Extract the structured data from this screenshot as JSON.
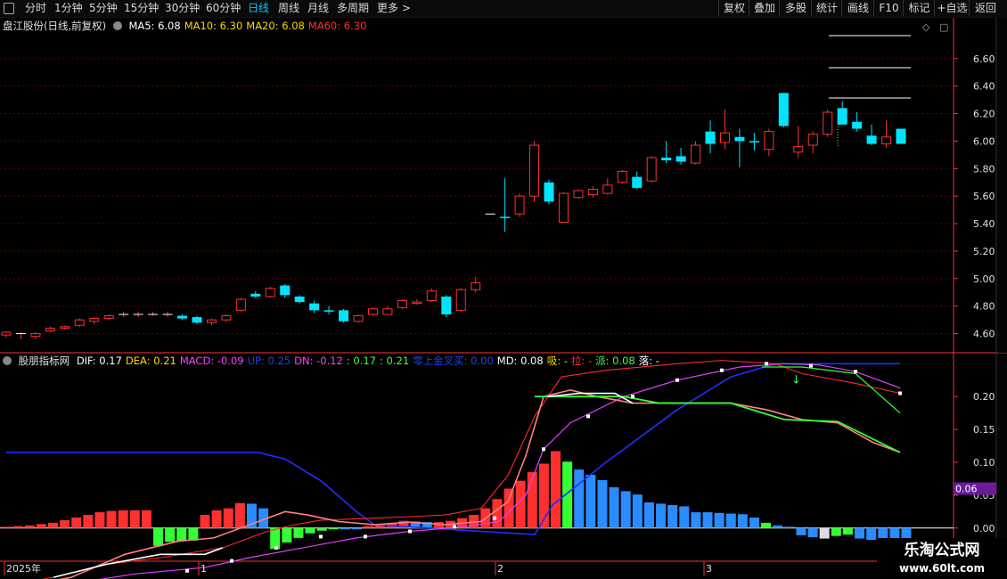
{
  "topbar": {
    "left_items": [
      {
        "label": "分时",
        "active": false
      },
      {
        "label": "1分钟",
        "active": false
      },
      {
        "label": "5分钟",
        "active": false
      },
      {
        "label": "15分钟",
        "active": false
      },
      {
        "label": "30分钟",
        "active": false
      },
      {
        "label": "60分钟",
        "active": false
      },
      {
        "label": "日线",
        "active": true
      },
      {
        "label": "周线",
        "active": false
      },
      {
        "label": "月线",
        "active": false
      },
      {
        "label": "多周期",
        "active": false
      },
      {
        "label": "更多 >",
        "active": false
      }
    ],
    "right_items": [
      "复权",
      "叠加",
      "多股",
      "统计",
      "画线",
      "F10",
      "标记",
      "+自选",
      "返回"
    ]
  },
  "price_panel": {
    "title": "盘江股份(日线,前复权)",
    "ma": [
      {
        "label": "MA5: 6.08",
        "color": "#ffffff"
      },
      {
        "label": "MA10: 6.30",
        "color": "#ffd700"
      },
      {
        "label": "MA20: 6.08",
        "color": "#ffd700"
      },
      {
        "label": "MA60: 6.30",
        "color": "#ff3030"
      }
    ],
    "y_ticks": [
      "6.60",
      "6.40",
      "6.20",
      "6.00",
      "5.80",
      "5.60",
      "5.40",
      "5.20",
      "5.00",
      "4.80",
      "4.60"
    ]
  },
  "indicator_panel": {
    "title": "股朋指标网",
    "items": [
      {
        "label": "DIF: 0.17",
        "color": "#ffffff"
      },
      {
        "label": "DEA: 0.21",
        "color": "#ffd700"
      },
      {
        "label": "MACD: -0.09",
        "color": "#ff40ff"
      },
      {
        "label": "UP: 0.25",
        "color": "#2040ff"
      },
      {
        "label": "DN: -0.12",
        "color": "#ff40ff"
      },
      {
        "label": ": 0.17",
        "color": "#40ff40"
      },
      {
        "label": ": 0.21",
        "color": "#40ff40"
      },
      {
        "label": "零上金叉买: 0.00",
        "color": "#2040ff"
      },
      {
        "label": "MD: 0.08",
        "color": "#ffffff"
      },
      {
        "label": "吸: -",
        "color": "#ffd700"
      },
      {
        "label": "拉: -",
        "color": "#ff3030"
      },
      {
        "label": "派: 0.08",
        "color": "#40ff40"
      },
      {
        "label": "落: -",
        "color": "#ffffff"
      }
    ],
    "y_ticks": [
      "0.20",
      "0.15",
      "0.10",
      "0.05",
      "0.00"
    ],
    "value_badge": "0.06"
  },
  "time_axis": [
    {
      "label": "2025年"
    },
    {
      "label": "1"
    },
    {
      "label": "2"
    },
    {
      "label": "3"
    }
  ],
  "watermark": {
    "line1": "乐淘公式网",
    "line2": "www.60lt.com"
  },
  "colors": {
    "up": "#ff3030",
    "down": "#00e5ff",
    "grid": "#5a0000",
    "axis": "#ff3030"
  },
  "chart_data": {
    "type": "candlestick",
    "ylim": [
      4.5,
      6.78
    ],
    "candles": [
      {
        "o": 4.59,
        "h": 4.62,
        "l": 4.57,
        "c": 4.61
      },
      {
        "o": 4.6,
        "h": 4.61,
        "l": 4.56,
        "c": 4.6
      },
      {
        "o": 4.58,
        "h": 4.61,
        "l": 4.56,
        "c": 4.6
      },
      {
        "o": 4.62,
        "h": 4.65,
        "l": 4.61,
        "c": 4.64
      },
      {
        "o": 4.64,
        "h": 4.66,
        "l": 4.63,
        "c": 4.65
      },
      {
        "o": 4.66,
        "h": 4.71,
        "l": 4.65,
        "c": 4.7
      },
      {
        "o": 4.69,
        "h": 4.72,
        "l": 4.67,
        "c": 4.71
      },
      {
        "o": 4.71,
        "h": 4.74,
        "l": 4.7,
        "c": 4.73
      },
      {
        "o": 4.74,
        "h": 4.76,
        "l": 4.72,
        "c": 4.74
      },
      {
        "o": 4.74,
        "h": 4.76,
        "l": 4.72,
        "c": 4.74
      },
      {
        "o": 4.74,
        "h": 4.76,
        "l": 4.73,
        "c": 4.74
      },
      {
        "o": 4.74,
        "h": 4.76,
        "l": 4.72,
        "c": 4.74
      },
      {
        "o": 4.73,
        "h": 4.74,
        "l": 4.7,
        "c": 4.71
      },
      {
        "o": 4.72,
        "h": 4.73,
        "l": 4.67,
        "c": 4.68
      },
      {
        "o": 4.68,
        "h": 4.71,
        "l": 4.66,
        "c": 4.7
      },
      {
        "o": 4.7,
        "h": 4.74,
        "l": 4.69,
        "c": 4.73
      },
      {
        "o": 4.77,
        "h": 4.86,
        "l": 4.76,
        "c": 4.85
      },
      {
        "o": 4.89,
        "h": 4.91,
        "l": 4.86,
        "c": 4.87
      },
      {
        "o": 4.87,
        "h": 4.94,
        "l": 4.86,
        "c": 4.93
      },
      {
        "o": 4.95,
        "h": 4.96,
        "l": 4.86,
        "c": 4.88
      },
      {
        "o": 4.87,
        "h": 4.88,
        "l": 4.82,
        "c": 4.83
      },
      {
        "o": 4.82,
        "h": 4.84,
        "l": 4.75,
        "c": 4.77
      },
      {
        "o": 4.77,
        "h": 4.8,
        "l": 4.74,
        "c": 4.76
      },
      {
        "o": 4.77,
        "h": 4.78,
        "l": 4.68,
        "c": 4.69
      },
      {
        "o": 4.69,
        "h": 4.74,
        "l": 4.68,
        "c": 4.73
      },
      {
        "o": 4.74,
        "h": 4.79,
        "l": 4.73,
        "c": 4.78
      },
      {
        "o": 4.74,
        "h": 4.8,
        "l": 4.74,
        "c": 4.78
      },
      {
        "o": 4.79,
        "h": 4.85,
        "l": 4.78,
        "c": 4.84
      },
      {
        "o": 4.82,
        "h": 4.85,
        "l": 4.81,
        "c": 4.83
      },
      {
        "o": 4.84,
        "h": 4.93,
        "l": 4.83,
        "c": 4.91
      },
      {
        "o": 4.87,
        "h": 4.88,
        "l": 4.72,
        "c": 4.74
      },
      {
        "o": 4.77,
        "h": 4.93,
        "l": 4.76,
        "c": 4.92
      },
      {
        "o": 4.92,
        "h": 5.01,
        "l": 4.9,
        "c": 4.97
      },
      {
        "o": 5.47,
        "h": 5.47,
        "l": 5.47,
        "c": 5.47
      },
      {
        "o": 5.45,
        "h": 5.73,
        "l": 5.34,
        "c": 5.44
      },
      {
        "o": 5.47,
        "h": 5.62,
        "l": 5.45,
        "c": 5.6
      },
      {
        "o": 5.6,
        "h": 6.0,
        "l": 5.56,
        "c": 5.97
      },
      {
        "o": 5.7,
        "h": 5.72,
        "l": 5.54,
        "c": 5.56
      },
      {
        "o": 5.41,
        "h": 5.63,
        "l": 5.41,
        "c": 5.62
      },
      {
        "o": 5.59,
        "h": 5.65,
        "l": 5.58,
        "c": 5.64
      },
      {
        "o": 5.61,
        "h": 5.67,
        "l": 5.59,
        "c": 5.65
      },
      {
        "o": 5.62,
        "h": 5.73,
        "l": 5.61,
        "c": 5.68
      },
      {
        "o": 5.7,
        "h": 5.79,
        "l": 5.69,
        "c": 5.78
      },
      {
        "o": 5.74,
        "h": 5.78,
        "l": 5.65,
        "c": 5.66
      },
      {
        "o": 5.71,
        "h": 5.89,
        "l": 5.7,
        "c": 5.88
      },
      {
        "o": 5.88,
        "h": 6.0,
        "l": 5.84,
        "c": 5.86
      },
      {
        "o": 5.89,
        "h": 5.95,
        "l": 5.83,
        "c": 5.85
      },
      {
        "o": 5.84,
        "h": 6.0,
        "l": 5.83,
        "c": 5.97
      },
      {
        "o": 6.07,
        "h": 6.15,
        "l": 5.91,
        "c": 5.98
      },
      {
        "o": 5.99,
        "h": 6.23,
        "l": 5.94,
        "c": 6.06
      },
      {
        "o": 6.03,
        "h": 6.09,
        "l": 5.81,
        "c": 6.0
      },
      {
        "o": 6.0,
        "h": 6.06,
        "l": 5.93,
        "c": 5.99
      },
      {
        "o": 5.94,
        "h": 6.09,
        "l": 5.89,
        "c": 6.07
      },
      {
        "o": 6.35,
        "h": 6.35,
        "l": 6.1,
        "c": 6.11
      },
      {
        "o": 5.92,
        "h": 6.11,
        "l": 5.88,
        "c": 5.96
      },
      {
        "o": 5.97,
        "h": 6.07,
        "l": 5.91,
        "c": 6.05
      },
      {
        "o": 6.05,
        "h": 6.23,
        "l": 6.03,
        "c": 6.21
      },
      {
        "o": 6.24,
        "h": 6.29,
        "l": 6.19,
        "c": 6.12
      },
      {
        "o": 6.14,
        "h": 6.21,
        "l": 6.07,
        "c": 6.09
      },
      {
        "o": 6.04,
        "h": 6.12,
        "l": 5.97,
        "c": 5.98
      },
      {
        "o": 5.98,
        "h": 6.15,
        "l": 5.95,
        "c": 6.03
      },
      {
        "o": 6.09,
        "h": 6.09,
        "l": 5.98,
        "c": 5.98
      }
    ],
    "macd_bars": [
      0.002,
      0.003,
      0.004,
      0.006,
      0.008,
      0.012,
      0.016,
      0.02,
      0.024,
      0.026,
      0.027,
      0.027,
      0.027,
      -0.027,
      -0.021,
      -0.02,
      -0.019,
      0.02,
      0.027,
      0.03,
      0.038,
      0.037,
      0.03,
      -0.032,
      -0.022,
      -0.015,
      -0.008,
      -0.004,
      -0.002,
      -0.002,
      -0.002,
      0.003,
      0.005,
      0.008,
      0.011,
      0.01,
      0.009,
      0.009,
      0.011,
      0.015,
      0.02,
      0.03,
      0.044,
      0.06,
      0.072,
      0.085,
      0.098,
      0.117,
      0.101,
      0.089,
      0.081,
      0.073,
      0.062,
      0.056,
      0.051,
      0.039,
      0.037,
      0.035,
      0.033,
      0.024,
      0.024,
      0.023,
      0.022,
      0.021,
      0.016,
      0.008,
      0.004,
      0.002,
      -0.011,
      -0.014,
      -0.016,
      -0.012,
      -0.01,
      -0.016,
      -0.018,
      -0.023,
      -0.028,
      -0.036
    ]
  }
}
